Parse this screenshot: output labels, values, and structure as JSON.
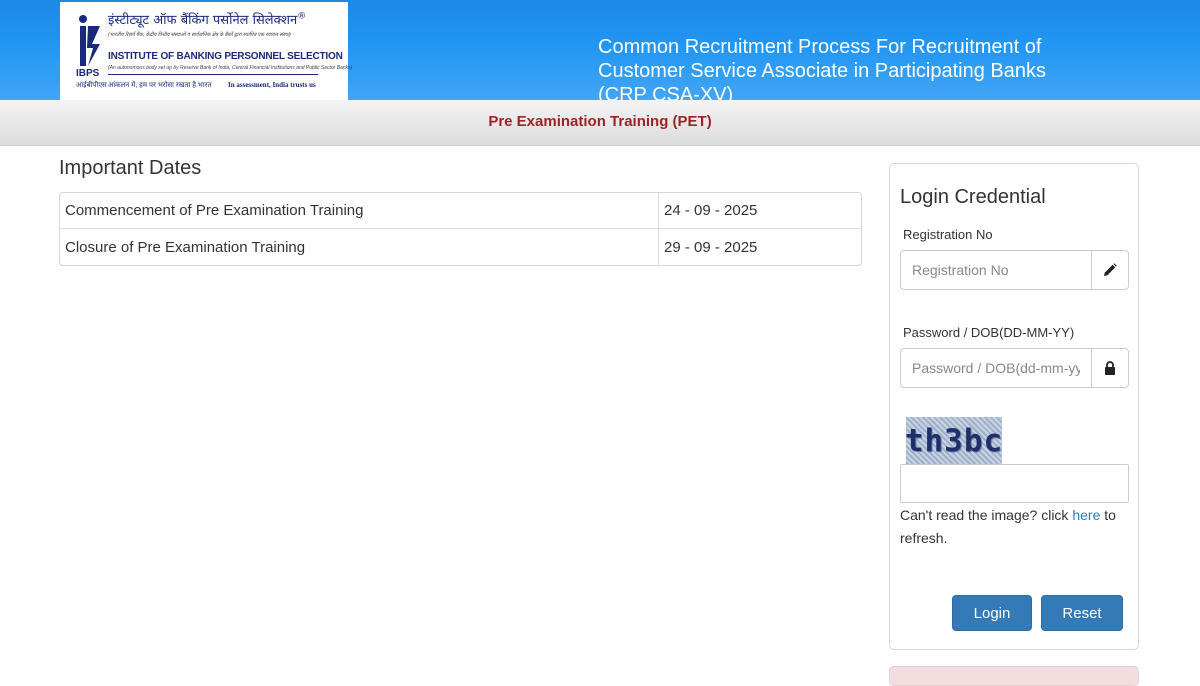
{
  "header": {
    "logo": {
      "hindi_title": "इंस्टीट्यूट ऑफ बैंकिंग पर्सोनेल सिलेक्शन",
      "hindi_subtitle": "(भारतीय रिज़र्व बैंक, केंद्रीय वित्तीय संस्थाओं व सार्वजनिक क्षेत्र के बैंकों द्वारा स्थापित एक स्वायत्त संस्था)",
      "english_title": "INSTITUTE OF BANKING PERSONNEL SELECTION",
      "english_subtitle": "(An autonomous body set up by Reserve Bank of India, Central Financial Institutions and Public Sector Banks)",
      "abbreviation": "IBPS",
      "abbreviation_hindi": "आईबीपीएस",
      "tagline_hindi": "आंकलन में, हम पर भरोसा रखता है भारत",
      "tagline_english": "In assessment, India trusts us",
      "registered_mark": "®"
    },
    "title": "Common Recruitment Process For Recruitment of Customer Service Associate in Participating Banks (CRP CSA-XV)"
  },
  "subheader": {
    "title": "Pre Examination Training (PET)"
  },
  "important_dates": {
    "heading": "Important Dates",
    "rows": [
      {
        "label": "Commencement of Pre Examination Training",
        "date": "24 - 09 - 2025"
      },
      {
        "label": "Closure of Pre Examination Training",
        "date": "29 - 09 - 2025"
      }
    ]
  },
  "login": {
    "title": "Login Credential",
    "registration_label": "Registration No",
    "registration_placeholder": "Registration No",
    "registration_value": "",
    "password_label": "Password / DOB(DD-MM-YY)",
    "password_placeholder": "Password / DOB(dd-mm-yy)",
    "password_value": "",
    "captcha_text": "th3bc",
    "captcha_value": "",
    "captcha_help_prefix": "Can't read the image? click ",
    "captcha_help_link": "here",
    "captcha_help_suffix": " to refresh.",
    "login_button": "Login",
    "reset_button": "Reset"
  },
  "colors": {
    "header_blue": "#2196f3",
    "subheader_title": "#9c2427",
    "button_primary": "#337ab7",
    "link": "#337ab7",
    "alert_bg": "#f2dede"
  },
  "icons": {
    "registration_addon": "pencil-icon",
    "password_addon": "lock-icon",
    "logo_mark": "ibps-logo-icon"
  }
}
